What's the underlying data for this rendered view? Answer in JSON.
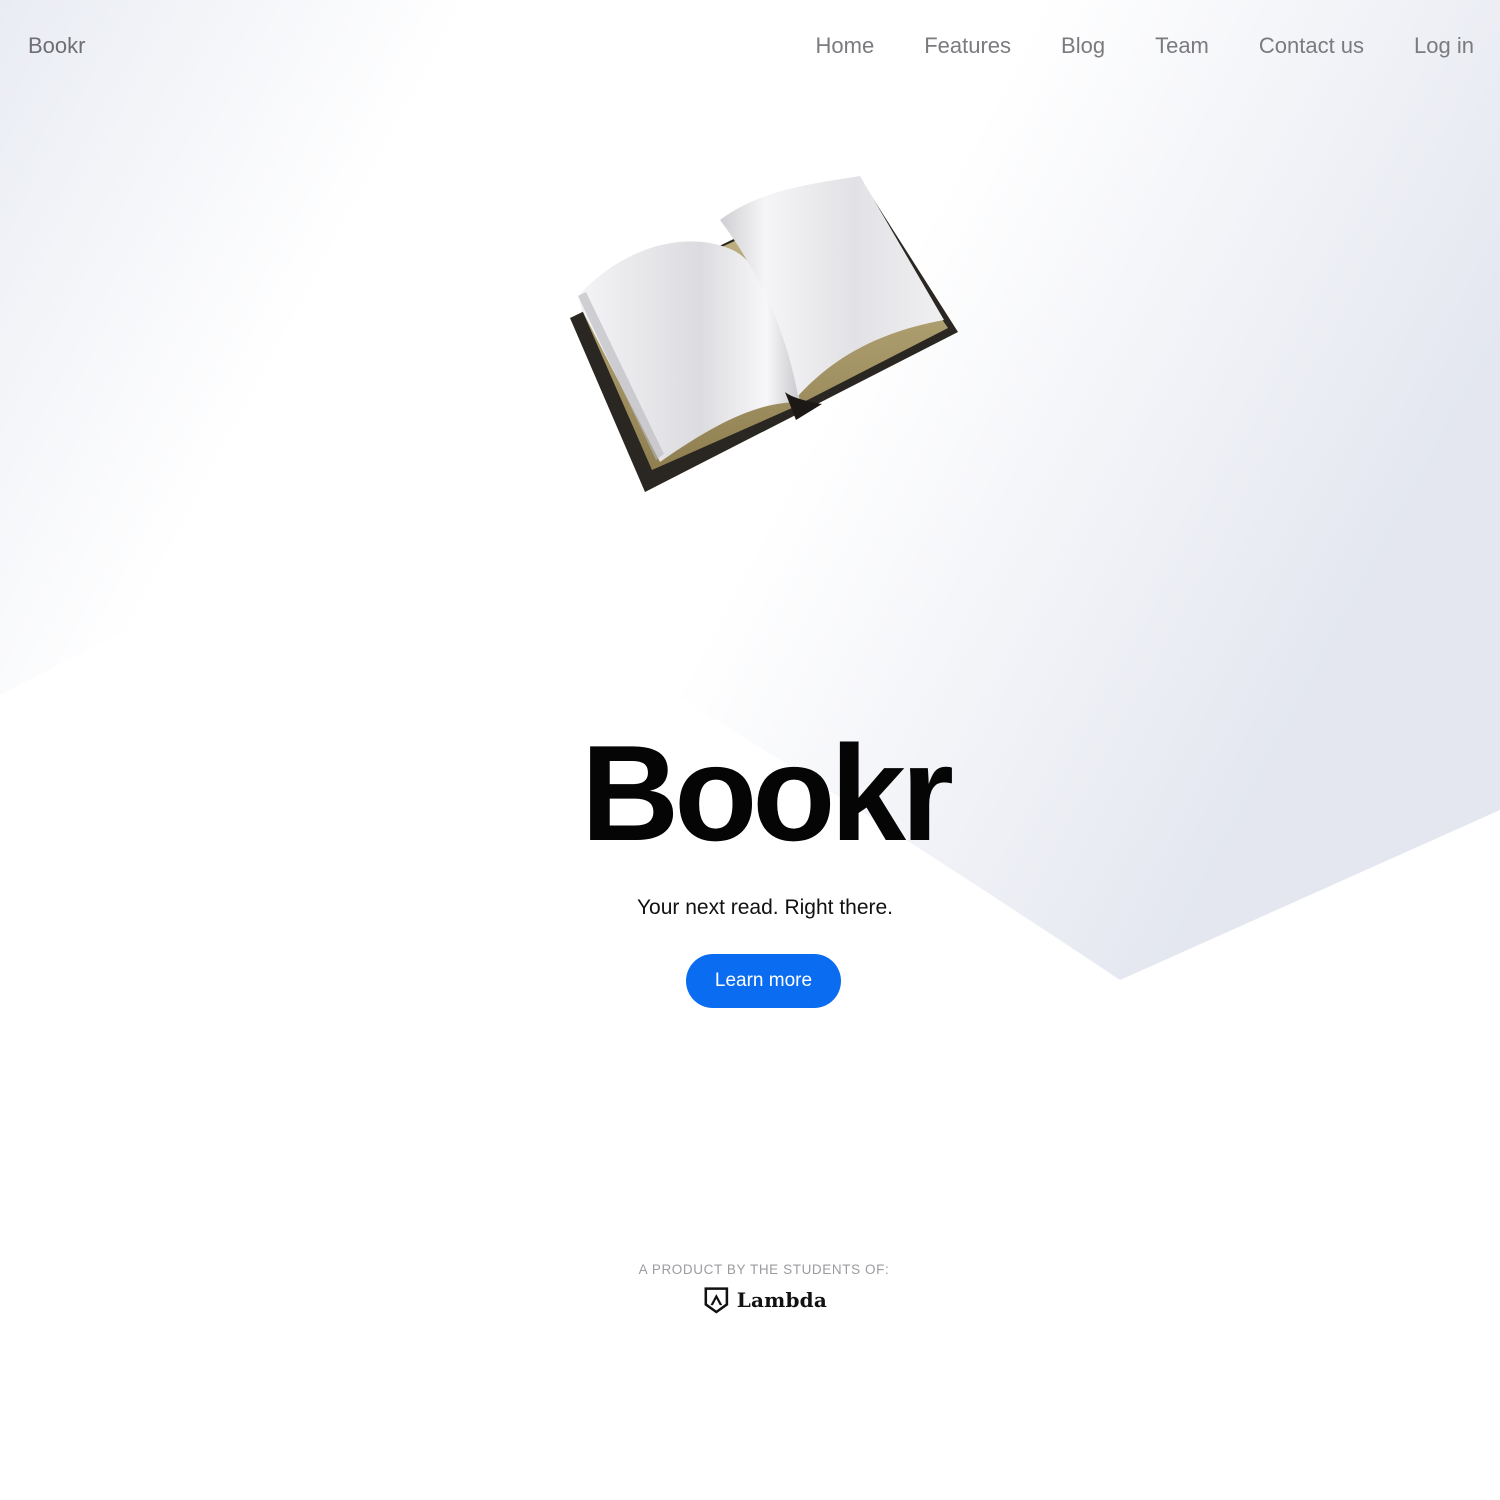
{
  "navbar": {
    "brand": "Bookr",
    "links": [
      {
        "label": "Home"
      },
      {
        "label": "Features"
      },
      {
        "label": "Blog"
      },
      {
        "label": "Team"
      },
      {
        "label": "Contact us"
      },
      {
        "label": "Log in"
      }
    ]
  },
  "hero": {
    "title": "Bookr",
    "subtitle": "Your next read. Right there.",
    "cta_label": "Learn more",
    "illustration_icon": "open-book-icon"
  },
  "footer": {
    "credit_label": "A PRODUCT BY THE STUDENTS OF:",
    "logo_text": "Lambda",
    "logo_icon": "lambda-shield-icon"
  },
  "colors": {
    "accent": "#0a6cf0",
    "nav_text": "#7a7a7f",
    "title_text": "#050505",
    "background_shape": "#e6e9f1"
  }
}
